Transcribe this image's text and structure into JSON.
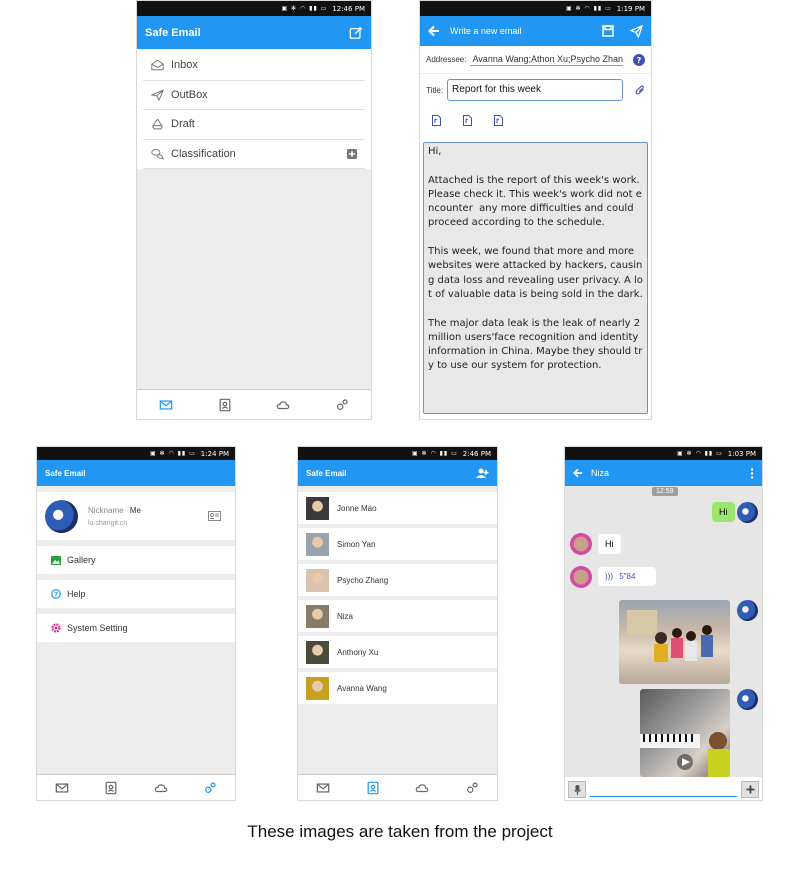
{
  "phone_inbox": {
    "status_time": "12:46 PM",
    "app_title": "Safe Email",
    "menu": [
      {
        "label": "Inbox",
        "icon": "envelope-open-icon"
      },
      {
        "label": "OutBox",
        "icon": "paper-plane-icon"
      },
      {
        "label": "Draft",
        "icon": "recycle-icon"
      },
      {
        "label": "Classification",
        "icon": "chat-bubbles-icon"
      }
    ]
  },
  "phone_compose": {
    "status_time": "1:19 PM",
    "app_title": "Write a new email",
    "addressee_label": "Addressee:",
    "addressee_value": "Avanna Wang;Athon Xu;Psycho Zhang;",
    "title_label": "Title:",
    "title_value": "Report for this week",
    "body": "Hi,\n\nAttached is the report of this week's work. Please check it. This week's work did not encounter  any more difficulties and could proceed according to the schedule.\n\nThis week, we found that more and more websites were attacked by hackers, causing data loss and revealing user privacy. A lot of valuable data is being sold in the dark.\n\nThe major data leak is the leak of nearly 2 million users'face recognition and identity information in China. Maybe they should try to use our system for protection."
  },
  "phone_profile": {
    "status_time": "1:24 PM",
    "app_title": "Safe Email",
    "nickname_label": "Nickname",
    "nickname_value": "Me",
    "email": "lu.changit.cn",
    "items": [
      {
        "label": "Gallery"
      },
      {
        "label": "Help"
      },
      {
        "label": "System Setting"
      }
    ]
  },
  "phone_contacts": {
    "status_time": "2:46 PM",
    "app_title": "Safe Email",
    "contacts": [
      {
        "name": "Jonne Mao",
        "color": "#3a3a3a"
      },
      {
        "name": "Simon Yan",
        "color": "#9aa3ae"
      },
      {
        "name": "Psycho Zhang",
        "color": "#d9c2b0"
      },
      {
        "name": "Niza",
        "color": "#8a7a6a"
      },
      {
        "name": "Anthony Xu",
        "color": "#4a4a3a"
      },
      {
        "name": "Avanna Wang",
        "color": "#c8a020"
      }
    ]
  },
  "phone_chat": {
    "status_time": "1:03 PM",
    "contact_name": "Niza",
    "time_stamp": "12:59",
    "msg_sent_1": "Hi",
    "msg_recv_1": "Hi",
    "voice_duration": "5\"84"
  },
  "caption": "These images are taken from the project",
  "colors": {
    "accent": "#2196f3",
    "pink": "#e91e8c"
  }
}
